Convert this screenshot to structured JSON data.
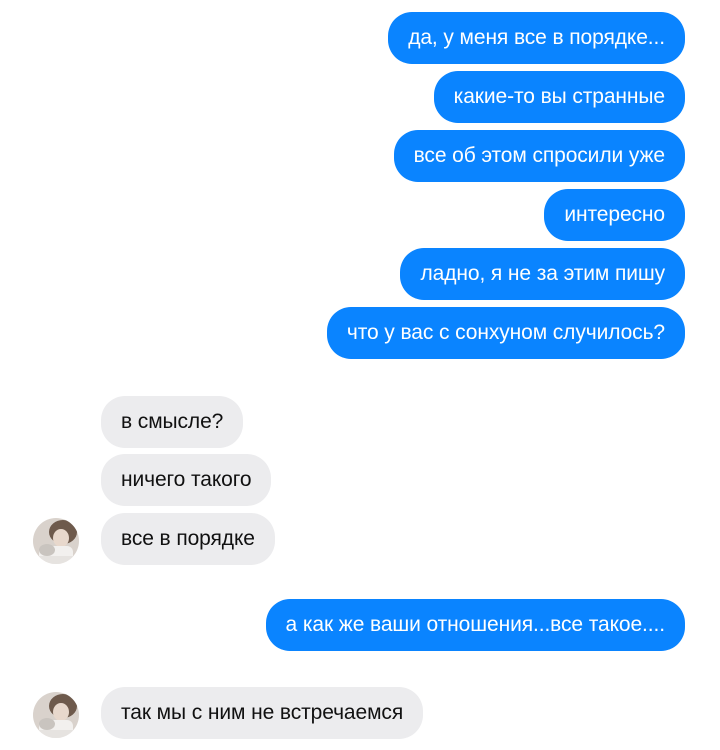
{
  "chat": {
    "outgoing_group_1": [
      "да, у меня все в порядке...",
      "какие-то вы странные",
      "все об этом спросили уже",
      "интересно",
      "ладно, я не за этим пишу",
      "что у вас с сонхуном случилось?"
    ],
    "incoming_group_1": [
      "в смысле?",
      "ничего такого",
      "все в порядке"
    ],
    "outgoing_group_2": [
      "а как же ваши отношения...все такое...."
    ],
    "incoming_group_2": [
      "так мы с ним не встречаемся"
    ]
  },
  "colors": {
    "outgoing_bubble": "#0a84ff",
    "incoming_bubble": "#ececee",
    "incoming_text": "#111111",
    "outgoing_text": "#ffffff"
  },
  "icons": {
    "avatar": "contact-avatar-photo"
  }
}
